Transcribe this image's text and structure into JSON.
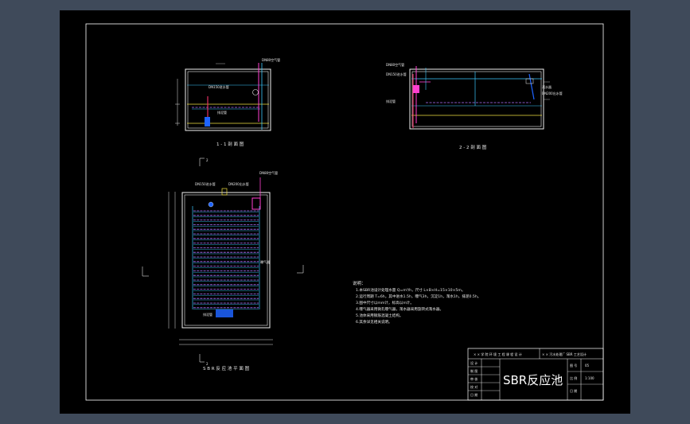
{
  "drawing": {
    "views": {
      "section_1_1": {
        "caption": "1 - 1 剖 面 图",
        "labels": [
          "DN80空气管",
          "排泥管",
          "DN150进水管"
        ]
      },
      "section_2_2": {
        "caption": "2 - 2 剖 面 图",
        "labels": [
          "DN80空气管",
          "DN150进水管",
          "排泥管",
          "滗水器",
          "DN200出水管"
        ]
      },
      "plan": {
        "caption": "S B R 反 应 池 平 面 图",
        "labels": [
          "DN80空气管",
          "DN150进水管",
          "DN200出水管",
          "曝气器",
          "排泥管"
        ],
        "section_marks": [
          "2",
          "2"
        ]
      }
    },
    "notes": {
      "heading": "说明：",
      "lines": [
        "1.本SBR池设计处理水量 Q=m³/h，尺寸 L×B×H=15×10×5m。",
        "2.运行周期 T=6h，其中进水1.5h，曝气3h，沉淀1h，滗水1h，排泥0.5h。",
        "3.图中尺寸以mm计，标高以m计。",
        "4.曝气器采用微孔曝气器，滗水器采用旋转式滗水器。",
        "5.池体采用钢筋混凝土结构。",
        "6.其余详见相关说明。"
      ]
    },
    "title_block": {
      "school": "× × 学 院 环 境 工 程 课 程 设 计",
      "project": "× × 污水处理厂 SBR 工艺设计",
      "drawing_title": "SBR反应池",
      "rows": [
        "设 计",
        "制 图",
        "审 核",
        "校 对",
        "日 期"
      ],
      "fields": [
        "图 号",
        "比 例",
        "日 期"
      ],
      "values": [
        "05",
        "1:100"
      ]
    }
  },
  "colors": {
    "outer_background": "#3f4a5a",
    "sheet": "#000000",
    "frame": "#ffffff",
    "wall": "#f0f0f0",
    "water_line": "#f0e040",
    "air_pipe": "#3cc8ff",
    "aerator_grid": "#b070ff",
    "sludge_pipe": "#e23060",
    "magenta_pipe": "#ff40d0",
    "inlet_blue": "#1e64ff",
    "green_pipe": "#40e060",
    "dimension": "#e0e0e0"
  }
}
